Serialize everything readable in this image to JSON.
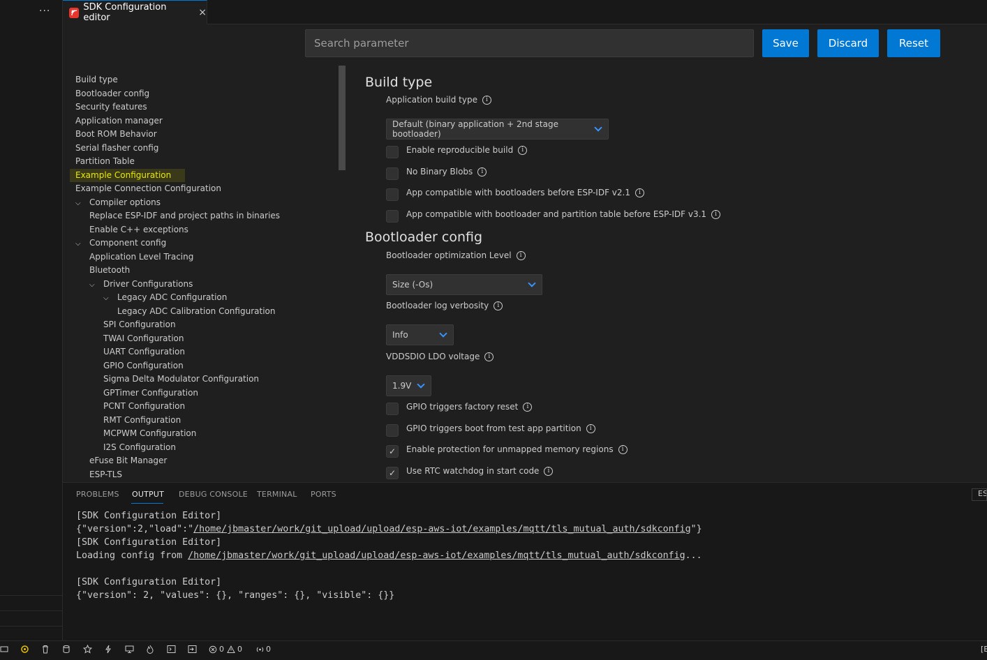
{
  "explorer": {
    "more_label": "···"
  },
  "tab": {
    "title": "SDK Configuration editor",
    "close": "×"
  },
  "toolbar": {
    "search_placeholder": "Search parameter",
    "save_label": "Save",
    "discard_label": "Discard",
    "reset_label": "Reset"
  },
  "tree": {
    "items": [
      {
        "label": "Build type",
        "chev": ""
      },
      {
        "label": "Bootloader config",
        "chev": ""
      },
      {
        "label": "Security features",
        "chev": ""
      },
      {
        "label": "Application manager",
        "chev": ""
      },
      {
        "label": "Boot ROM Behavior",
        "chev": ""
      },
      {
        "label": "Serial flasher config",
        "chev": ""
      },
      {
        "label": "Partition Table",
        "chev": ""
      },
      {
        "label": "Example Configuration",
        "chev": ""
      },
      {
        "label": "Example Connection Configuration",
        "chev": ""
      },
      {
        "label": "Compiler options",
        "chev": "⌵"
      },
      {
        "label": "Replace ESP-IDF and project paths in binaries",
        "chev": ""
      },
      {
        "label": "Enable C++ exceptions",
        "chev": ""
      },
      {
        "label": "Component config",
        "chev": "⌵"
      },
      {
        "label": "Application Level Tracing",
        "chev": ""
      },
      {
        "label": "Bluetooth",
        "chev": ""
      },
      {
        "label": "Driver Configurations",
        "chev": "⌵"
      },
      {
        "label": "Legacy ADC Configuration",
        "chev": "⌵"
      },
      {
        "label": "Legacy ADC Calibration Configuration",
        "chev": ""
      },
      {
        "label": "SPI Configuration",
        "chev": ""
      },
      {
        "label": "TWAI Configuration",
        "chev": ""
      },
      {
        "label": "UART Configuration",
        "chev": ""
      },
      {
        "label": "GPIO Configuration",
        "chev": ""
      },
      {
        "label": "Sigma Delta Modulator Configuration",
        "chev": ""
      },
      {
        "label": "GPTimer Configuration",
        "chev": ""
      },
      {
        "label": "PCNT Configuration",
        "chev": ""
      },
      {
        "label": "RMT Configuration",
        "chev": ""
      },
      {
        "label": "MCPWM Configuration",
        "chev": ""
      },
      {
        "label": "I2S Configuration",
        "chev": ""
      },
      {
        "label": "eFuse Bit Manager",
        "chev": ""
      },
      {
        "label": "ESP-TLS",
        "chev": ""
      }
    ]
  },
  "settings": {
    "build_type": {
      "title": "Build type",
      "app_build_type_label": "Application build type",
      "app_build_type_value": "Default (binary application + 2nd stage bootloader)",
      "reproducible_label": "Enable reproducible build",
      "no_blobs_label": "No Binary Blobs",
      "compat_v21_label": "App compatible with bootloaders before ESP-IDF v2.1",
      "compat_v31_label": "App compatible with bootloader and partition table before ESP-IDF v3.1"
    },
    "bootloader": {
      "title": "Bootloader config",
      "opt_level_label": "Bootloader optimization Level",
      "opt_level_value": "Size (-Os)",
      "log_verbosity_label": "Bootloader log verbosity",
      "log_verbosity_value": "Info",
      "vddsdio_label": "VDDSDIO LDO voltage",
      "vddsdio_value": "1.9V",
      "factory_reset_label": "GPIO triggers factory reset",
      "test_app_label": "GPIO triggers boot from test app partition",
      "unmapped_label": "Enable protection for unmapped memory regions",
      "rtc_wdt_label": "Use RTC watchdog in start code"
    },
    "checks": {
      "checked_mark": "✓",
      "info_mark": "i"
    }
  },
  "panel": {
    "tabs": [
      "PROBLEMS",
      "OUTPUT",
      "DEBUG CONSOLE",
      "TERMINAL",
      "PORTS"
    ],
    "right_label": "ES",
    "output": {
      "l1": "[SDK Configuration Editor]",
      "l2a": "{\"version\":2,\"load\":\"",
      "l2b": "/home/jbmaster/work/git_upload/upload/esp-aws-iot/examples/mqtt/tls_mutual_auth/sdkconfig",
      "l2c": "\"}",
      "l3": "[SDK Configuration Editor]",
      "l4a": "Loading config from ",
      "l4b": "/home/jbmaster/work/git_upload/upload/esp-aws-iot/examples/mqtt/tls_mutual_auth/sdkconfig",
      "l4c": "...",
      "l5": "",
      "l6": "[SDK Configuration Editor]",
      "l7": "{\"version\": 2, \"values\": {}, \"ranges\": {}, \"visible\": {}}"
    }
  },
  "statusbar": {
    "errors": "0",
    "warnings": "0",
    "ports": "0",
    "right": "[E"
  },
  "colors": {
    "accent": "#0078d4",
    "selected_text": "#e8e800"
  }
}
